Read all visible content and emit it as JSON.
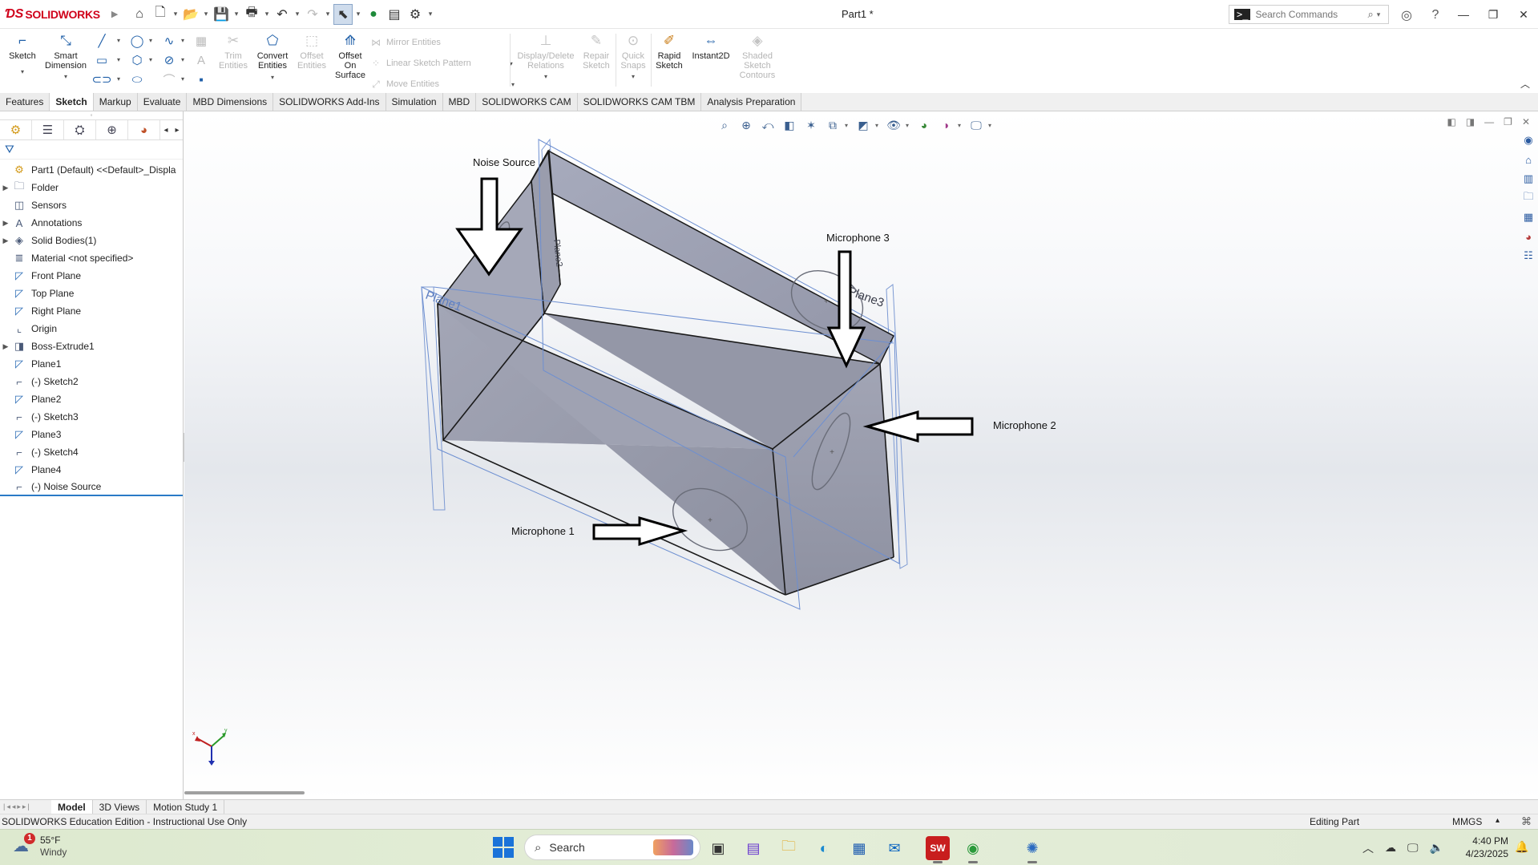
{
  "app": {
    "brand": "SOLIDWORKS",
    "doc_title": "Part1 *"
  },
  "search": {
    "placeholder": "Search Commands"
  },
  "ribbon": {
    "sketch": "Sketch",
    "smart_dimension": "Smart\nDimension",
    "trim": "Trim\nEntities",
    "convert": "Convert\nEntities",
    "offset": "Offset\nEntities",
    "offset_surface": "Offset\nOn\nSurface",
    "mirror": "Mirror Entities",
    "linear_pattern": "Linear Sketch Pattern",
    "move": "Move Entities",
    "display_delete": "Display/Delete\nRelations",
    "repair": "Repair\nSketch",
    "quick_snaps": "Quick\nSnaps",
    "rapid_sketch": "Rapid\nSketch",
    "instant2d": "Instant2D",
    "shaded_contours": "Shaded\nSketch\nContours"
  },
  "command_tabs": [
    "Features",
    "Sketch",
    "Markup",
    "Evaluate",
    "MBD Dimensions",
    "SOLIDWORKS Add-Ins",
    "Simulation",
    "MBD",
    "SOLIDWORKS CAM",
    "SOLIDWORKS CAM TBM",
    "Analysis Preparation"
  ],
  "active_command_tab": "Sketch",
  "tree": [
    {
      "label": "Part1 (Default) <<Default>_Displa",
      "icon": "part-icon",
      "expand": false,
      "root": true
    },
    {
      "label": "Folder",
      "icon": "folder-icon",
      "expand": true
    },
    {
      "label": "Sensors",
      "icon": "sensor-icon",
      "expand": false
    },
    {
      "label": "Annotations",
      "icon": "annotation-icon",
      "expand": true
    },
    {
      "label": "Solid Bodies(1)",
      "icon": "solid-bodies-icon",
      "expand": true
    },
    {
      "label": "Material <not specified>",
      "icon": "material-icon",
      "expand": false
    },
    {
      "label": "Front Plane",
      "icon": "plane-icon",
      "expand": false
    },
    {
      "label": "Top Plane",
      "icon": "plane-icon",
      "expand": false
    },
    {
      "label": "Right Plane",
      "icon": "plane-icon",
      "expand": false
    },
    {
      "label": "Origin",
      "icon": "origin-icon",
      "expand": false
    },
    {
      "label": "Boss-Extrude1",
      "icon": "extrude-icon",
      "expand": true
    },
    {
      "label": "Plane1",
      "icon": "plane-icon",
      "expand": false
    },
    {
      "label": "(-) Sketch2",
      "icon": "sketch-icon",
      "expand": false
    },
    {
      "label": "Plane2",
      "icon": "plane-icon",
      "expand": false
    },
    {
      "label": "(-) Sketch3",
      "icon": "sketch-icon",
      "expand": false
    },
    {
      "label": "Plane3",
      "icon": "plane-icon",
      "expand": false
    },
    {
      "label": "(-) Sketch4",
      "icon": "sketch-icon",
      "expand": false
    },
    {
      "label": "Plane4",
      "icon": "plane-icon",
      "expand": false
    },
    {
      "label": "(-) Noise Source",
      "icon": "sketch-icon",
      "expand": false
    }
  ],
  "viewport": {
    "annotations": {
      "noise_source": "Noise Source",
      "mic1": "Microphone 1",
      "mic2": "Microphone 2",
      "mic3": "Microphone 3"
    },
    "plane_labels": {
      "plane1": "Plane1",
      "plane2": "Plane2",
      "plane3": "Plane3"
    }
  },
  "bottom_tabs": [
    "Model",
    "3D Views",
    "Motion Study 1"
  ],
  "active_bottom_tab": "Model",
  "status": {
    "left": "SOLIDWORKS Education Edition - Instructional Use Only",
    "mode": "Editing Part",
    "units": "MMGS"
  },
  "taskbar": {
    "weather_temp": "55°F",
    "weather_cond": "Windy",
    "weather_badge": "1",
    "search_label": "Search",
    "time": "4:40 PM",
    "date": "4/23/2025"
  }
}
